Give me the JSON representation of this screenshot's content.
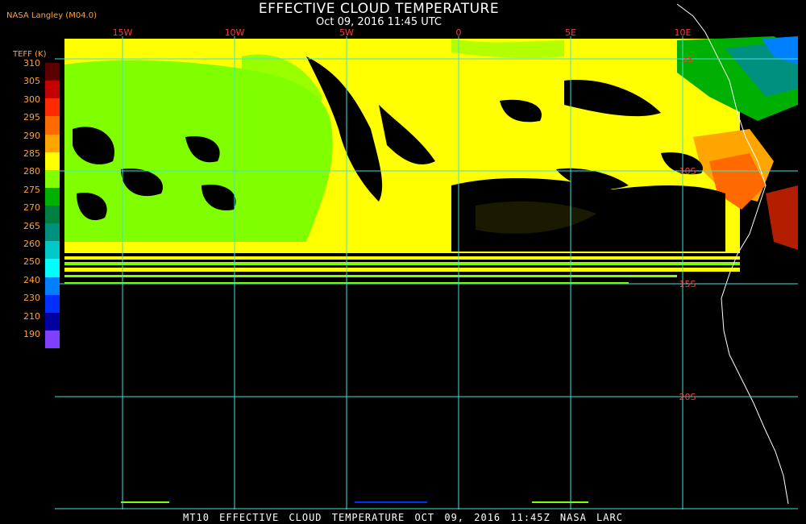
{
  "header": {
    "title": "EFFECTIVE CLOUD TEMPERATURE",
    "subtitle": "Oct 09, 2016 11:45 UTC",
    "brand": "NASA Langley (M04.0)"
  },
  "legend": {
    "title": "TEFF (K)",
    "ticks": [
      "310",
      "305",
      "300",
      "295",
      "290",
      "285",
      "280",
      "275",
      "270",
      "265",
      "260",
      "250",
      "240",
      "230",
      "210",
      "190"
    ],
    "colors": [
      "#5a0000",
      "#c40000",
      "#ff2a00",
      "#ff6a00",
      "#ffa500",
      "#ffff00",
      "#80ff00",
      "#00b000",
      "#008040",
      "#009080",
      "#00c8c8",
      "#00ffff",
      "#0080ff",
      "#0030ff",
      "#0000a0",
      "#8040ff"
    ]
  },
  "grid": {
    "lon_labels": [
      "15W",
      "10W",
      "5W",
      "0",
      "5E",
      "10E"
    ],
    "lat_labels": [
      "5S",
      "10S",
      "15S",
      "20S"
    ],
    "line_color": "#40e0e0",
    "label_color": "#ff3a3a"
  },
  "footer": {
    "text": "MT10  EFFECTIVE CLOUD TEMPERATURE  OCT 09, 2016 11:45Z  NASA LARC"
  }
}
